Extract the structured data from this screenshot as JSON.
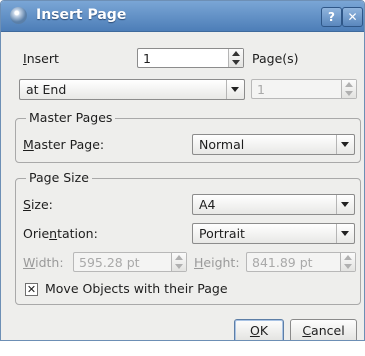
{
  "window": {
    "title": "Insert Page",
    "help_label": "?",
    "close_label": "✕",
    "icon": "app-icon"
  },
  "insert": {
    "label_pre": "",
    "label_mnemonic": "I",
    "label_post": "nsert",
    "count_value": "1",
    "suffix": "Page(s)",
    "position_value": "at End",
    "page_value": "1"
  },
  "master_pages": {
    "group_title": "Master Pages",
    "label_mnemonic": "M",
    "label_post": "aster Page:",
    "value": "Normal"
  },
  "page_size": {
    "group_title": "Page Size",
    "size_label_mnemonic": "S",
    "size_label_post": "ize:",
    "size_value": "A4",
    "orientation_label_pre": "Orie",
    "orientation_label_mnemonic": "n",
    "orientation_label_post": "tation:",
    "orientation_value": "Portrait",
    "width_label_mnemonic": "W",
    "width_label_post": "idth:",
    "width_value": "595.28 pt",
    "height_label_mnemonic": "H",
    "height_label_post": "eight:",
    "height_value": "841.89 pt",
    "move_objects_label": "Move Objects with their Page",
    "move_objects_checked": true,
    "check_mark": "✕"
  },
  "buttons": {
    "ok_mnemonic": "O",
    "ok_post": "K",
    "cancel_mnemonic": "C",
    "cancel_post": "ancel"
  }
}
